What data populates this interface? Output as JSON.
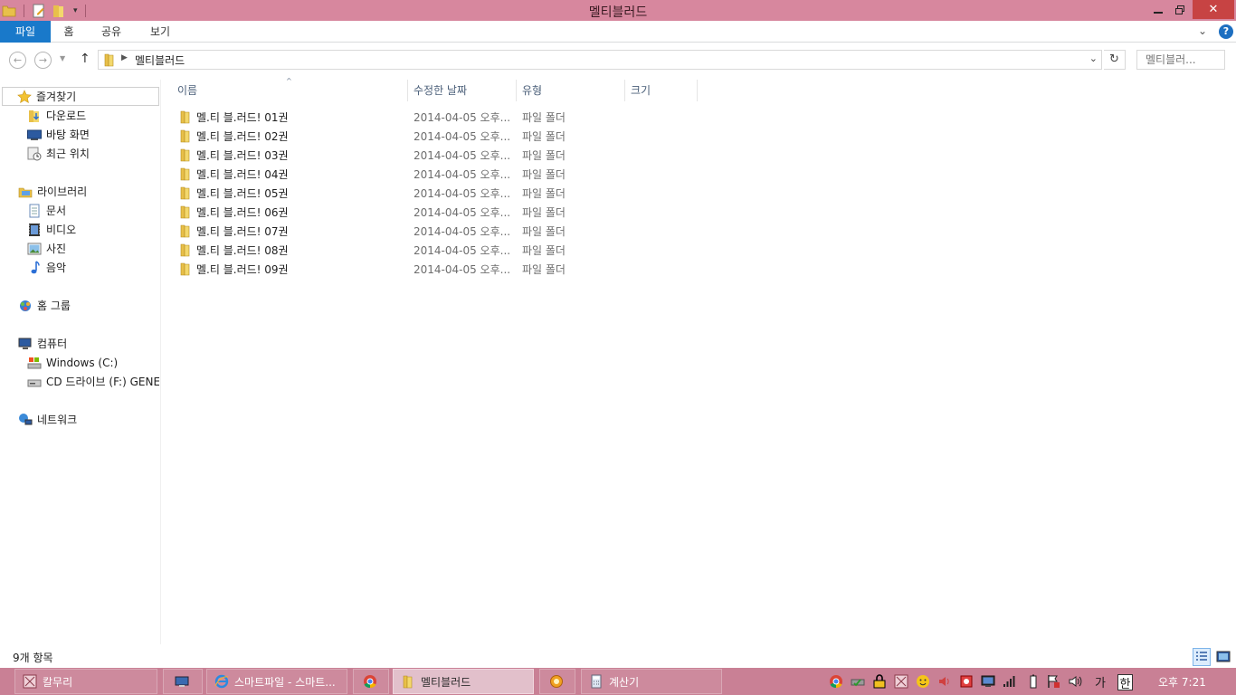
{
  "window": {
    "title": "멜티블러드"
  },
  "ribbon": {
    "tabs": [
      "파일",
      "홈",
      "공유",
      "보기"
    ]
  },
  "address": {
    "crumb": "멜티블러드",
    "search_placeholder": "멜티블러..."
  },
  "columns": {
    "name": "이름",
    "date": "수정한 날짜",
    "type": "유형",
    "size": "크기"
  },
  "nav": {
    "favorites": "즐겨찾기",
    "favorites_items": [
      "다운로드",
      "바탕 화면",
      "최근 위치"
    ],
    "libraries": "라이브러리",
    "libraries_items": [
      "문서",
      "비디오",
      "사진",
      "음악"
    ],
    "homegroup": "홈 그룹",
    "computer": "컴퓨터",
    "computer_items": [
      "Windows (C:)",
      "CD 드라이브 (F:) GENEI"
    ],
    "network": "네트워크"
  },
  "files": [
    {
      "name": "멜.티 블.러드! 01권",
      "date": "2014-04-05 오후...",
      "type": "파일 폴더"
    },
    {
      "name": "멜.티 블.러드! 02권",
      "date": "2014-04-05 오후...",
      "type": "파일 폴더"
    },
    {
      "name": "멜.티 블.러드! 03권",
      "date": "2014-04-05 오후...",
      "type": "파일 폴더"
    },
    {
      "name": "멜.티 블.러드! 04권",
      "date": "2014-04-05 오후...",
      "type": "파일 폴더"
    },
    {
      "name": "멜.티 블.러드! 05권",
      "date": "2014-04-05 오후...",
      "type": "파일 폴더"
    },
    {
      "name": "멜.티 블.러드! 06권",
      "date": "2014-04-05 오후...",
      "type": "파일 폴더"
    },
    {
      "name": "멜.티 블.러드! 07권",
      "date": "2014-04-05 오후...",
      "type": "파일 폴더"
    },
    {
      "name": "멜.티 블.러드! 08권",
      "date": "2014-04-05 오후...",
      "type": "파일 폴더"
    },
    {
      "name": "멜.티 블.러드! 09권",
      "date": "2014-04-05 오후...",
      "type": "파일 폴더"
    }
  ],
  "status": {
    "count": "9개 항목"
  },
  "taskbar": {
    "items": [
      "칼무리",
      "스마트파일 - 스마트...",
      "멜티블러드",
      "계산기"
    ],
    "tray_text": [
      "가",
      "한"
    ],
    "clock": "오후 7:21"
  },
  "colors": {
    "titlebar": "#d7879e",
    "taskbar": "#c98095",
    "file_tab": "#1979ca",
    "folder": "#e8c04a"
  }
}
